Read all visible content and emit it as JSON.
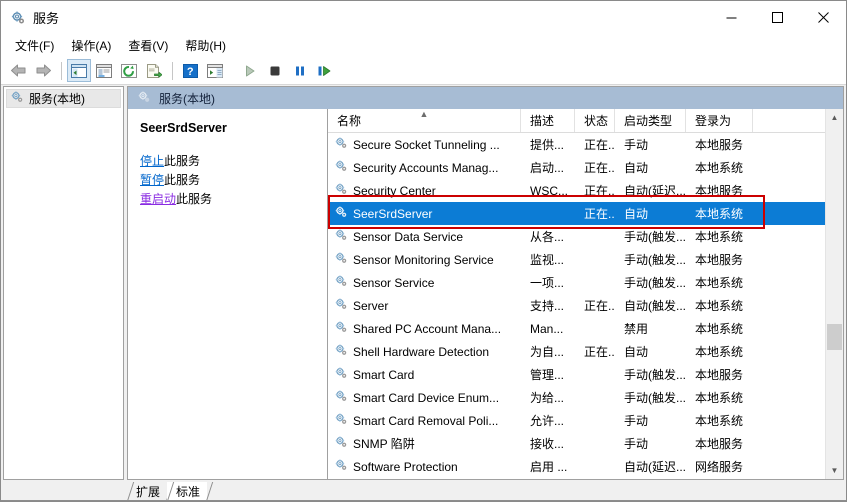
{
  "window": {
    "title": "服务",
    "icon": "services-gear-icon",
    "minimize_label": "最小化",
    "maximize_label": "最大化",
    "close_label": "关闭"
  },
  "menu": {
    "items": [
      {
        "label": "文件(F)",
        "name": "menu-file"
      },
      {
        "label": "操作(A)",
        "name": "menu-action"
      },
      {
        "label": "查看(V)",
        "name": "menu-view"
      },
      {
        "label": "帮助(H)",
        "name": "menu-help"
      }
    ]
  },
  "toolbar": {
    "buttons": [
      {
        "name": "back-button",
        "icon": "arrow-left-icon"
      },
      {
        "name": "forward-button",
        "icon": "arrow-right-icon"
      },
      {
        "name": "show-hide-tree-button",
        "icon": "tree-pane-icon"
      },
      {
        "name": "properties-button",
        "icon": "properties-icon"
      },
      {
        "name": "refresh-button",
        "icon": "refresh-icon"
      },
      {
        "name": "export-list-button",
        "icon": "export-icon"
      },
      {
        "name": "help-button",
        "icon": "question-mark-icon"
      },
      {
        "name": "show-action-pane-button",
        "icon": "action-pane-icon"
      },
      {
        "name": "start-service-button",
        "icon": "play-icon"
      },
      {
        "name": "stop-service-button",
        "icon": "stop-icon"
      },
      {
        "name": "pause-service-button",
        "icon": "pause-icon"
      },
      {
        "name": "restart-service-button",
        "icon": "restart-icon"
      }
    ]
  },
  "tree": {
    "root_label": "服务(本地)",
    "root_icon": "services-gear-icon"
  },
  "pane": {
    "header_label": "服务(本地)",
    "header_icon": "services-gear-icon"
  },
  "details": {
    "service_name": "SeerSrdServer",
    "links": [
      {
        "action": "停止",
        "suffix": "此服务",
        "name": "stop-service-link",
        "state": "normal"
      },
      {
        "action": "暂停",
        "suffix": "此服务",
        "name": "pause-service-link",
        "state": "normal"
      },
      {
        "action": "重启动",
        "suffix": "此服务",
        "name": "restart-service-link",
        "state": "visited"
      }
    ]
  },
  "list": {
    "columns": [
      {
        "label": "名称",
        "name": "column-name",
        "width": 193,
        "sorted": "asc"
      },
      {
        "label": "描述",
        "name": "column-description",
        "width": 54
      },
      {
        "label": "状态",
        "name": "column-status",
        "width": 40
      },
      {
        "label": "启动类型",
        "name": "column-startup-type",
        "width": 71
      },
      {
        "label": "登录为",
        "name": "column-log-on-as",
        "width": 67
      }
    ],
    "rows": [
      {
        "name": "Secure Socket Tunneling ...",
        "description": "提供...",
        "status": "正在...",
        "startup": "手动",
        "logon": "本地服务",
        "selected": false
      },
      {
        "name": "Security Accounts Manag...",
        "description": "启动...",
        "status": "正在...",
        "startup": "自动",
        "logon": "本地系统",
        "selected": false
      },
      {
        "name": "Security Center",
        "description": "WSC...",
        "status": "正在...",
        "startup": "自动(延迟...",
        "logon": "本地服务",
        "selected": false
      },
      {
        "name": "SeerSrdServer",
        "description": "",
        "status": "正在...",
        "startup": "自动",
        "logon": "本地系统",
        "selected": true
      },
      {
        "name": "Sensor Data Service",
        "description": "从各...",
        "status": "",
        "startup": "手动(触发...",
        "logon": "本地系统",
        "selected": false
      },
      {
        "name": "Sensor Monitoring Service",
        "description": "监视...",
        "status": "",
        "startup": "手动(触发...",
        "logon": "本地服务",
        "selected": false
      },
      {
        "name": "Sensor Service",
        "description": "一项...",
        "status": "",
        "startup": "手动(触发...",
        "logon": "本地系统",
        "selected": false
      },
      {
        "name": "Server",
        "description": "支持...",
        "status": "正在...",
        "startup": "自动(触发...",
        "logon": "本地系统",
        "selected": false
      },
      {
        "name": "Shared PC Account Mana...",
        "description": "Man...",
        "status": "",
        "startup": "禁用",
        "logon": "本地系统",
        "selected": false
      },
      {
        "name": "Shell Hardware Detection",
        "description": "为自...",
        "status": "正在...",
        "startup": "自动",
        "logon": "本地系统",
        "selected": false
      },
      {
        "name": "Smart Card",
        "description": "管理...",
        "status": "",
        "startup": "手动(触发...",
        "logon": "本地服务",
        "selected": false
      },
      {
        "name": "Smart Card Device Enum...",
        "description": "为给...",
        "status": "",
        "startup": "手动(触发...",
        "logon": "本地系统",
        "selected": false
      },
      {
        "name": "Smart Card Removal Poli...",
        "description": "允许...",
        "status": "",
        "startup": "手动",
        "logon": "本地系统",
        "selected": false
      },
      {
        "name": "SNMP 陷阱",
        "description": "接收...",
        "status": "",
        "startup": "手动",
        "logon": "本地服务",
        "selected": false
      },
      {
        "name": "Software Protection",
        "description": "启用 ...",
        "status": "",
        "startup": "自动(延迟...",
        "logon": "网络服务",
        "selected": false
      }
    ],
    "scrollbar": {
      "up_glyph": "▲",
      "down_glyph": "▼",
      "thumb_position_pct": 59
    }
  },
  "annotation": {
    "color": "#cc0000",
    "target": "SeerSrdServer"
  },
  "tabs": [
    {
      "label": "扩展",
      "name": "tab-extended",
      "active": false
    },
    {
      "label": "标准",
      "name": "tab-standard",
      "active": true
    }
  ],
  "colors": {
    "selection_blue": "#0c7cd5",
    "pane_header": "#a7bcd4",
    "link_blue": "#0066cc",
    "link_visited": "#8a2be2",
    "annotation_red": "#cc0000"
  }
}
